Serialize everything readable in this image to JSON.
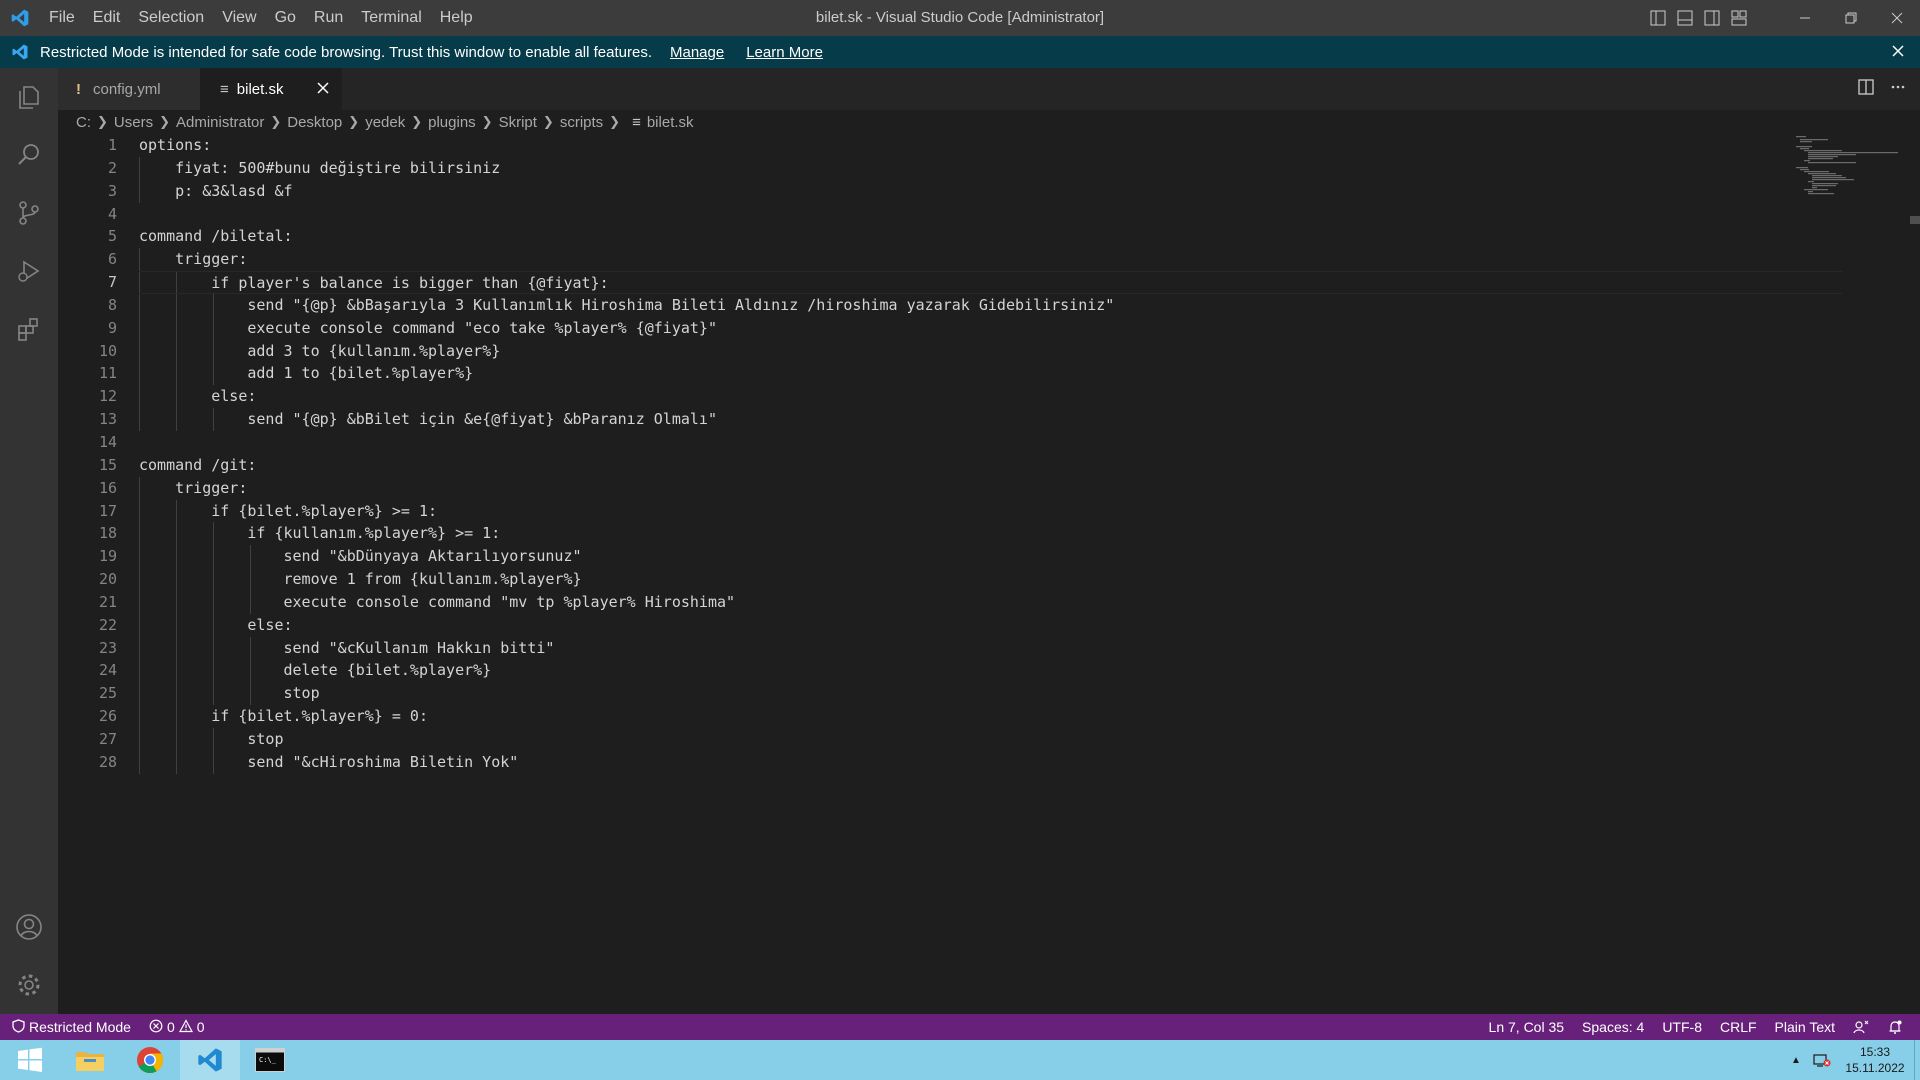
{
  "titlebar": {
    "menu": [
      "File",
      "Edit",
      "Selection",
      "View",
      "Go",
      "Run",
      "Terminal",
      "Help"
    ],
    "window_title": "bilet.sk - Visual Studio Code [Administrator]"
  },
  "banner": {
    "message": "Restricted Mode is intended for safe code browsing. Trust this window to enable all features.",
    "manage": "Manage",
    "learn_more": "Learn More"
  },
  "tabs": [
    {
      "label": "config.yml",
      "marker": "!"
    },
    {
      "label": "bilet.sk",
      "marker": "≡"
    }
  ],
  "breadcrumb": [
    "C:",
    "Users",
    "Administrator",
    "Desktop",
    "yedek",
    "plugins",
    "Skript",
    "scripts",
    "bilet.sk"
  ],
  "editor": {
    "line_numbers": [
      "1",
      "2",
      "3",
      "4",
      "5",
      "6",
      "7",
      "8",
      "9",
      "10",
      "11",
      "12",
      "13",
      "14",
      "15",
      "16",
      "17",
      "18",
      "19",
      "20",
      "21",
      "22",
      "23",
      "24",
      "25",
      "26",
      "27",
      "28"
    ],
    "lines": [
      "options:",
      "    fiyat: 500#bunu değiştire bilirsiniz",
      "    p: &3&lasd &f",
      "",
      "command /biletal:",
      "    trigger:",
      "        if player's balance is bigger than {@fiyat}:",
      "            send \"{@p} &bBaşarıyla 3 Kullanımlık Hiroshima Bileti Aldınız /hiroshima yazarak Gidebilirsiniz\"",
      "            execute console command \"eco take %player% {@fiyat}\"",
      "            add 3 to {kullanım.%player%}",
      "            add 1 to {bilet.%player%}",
      "        else:",
      "            send \"{@p} &bBilet için &e{@fiyat} &bParanız Olmalı\"",
      "",
      "command /git:",
      "    trigger:",
      "        if {bilet.%player%} >= 1:",
      "            if {kullanım.%player%} >= 1:",
      "                send \"&bDünyaya Aktarılıyorsunuz\"",
      "                remove 1 from {kullanım.%player%}",
      "                execute console command \"mv tp %player% Hiroshima\"",
      "            else:",
      "                send \"&cKullanım Hakkın bitti\"",
      "                delete {bilet.%player%}",
      "                stop",
      "        if {bilet.%player%} = 0:",
      "            stop",
      "            send \"&cHiroshima Biletin Yok\""
    ],
    "active_line": 7
  },
  "statusbar": {
    "restricted": "Restricted Mode",
    "errors": "0",
    "warnings": "0",
    "position": "Ln 7, Col 35",
    "spaces": "Spaces: 4",
    "encoding": "UTF-8",
    "eol": "CRLF",
    "language": "Plain Text"
  },
  "taskbar": {
    "time": "15:33",
    "date": "15.11.2022"
  },
  "colors": {
    "statusbar": "#68217a",
    "banner": "#063b49",
    "accent": "#007acc",
    "taskbar": "#87cfe8"
  }
}
